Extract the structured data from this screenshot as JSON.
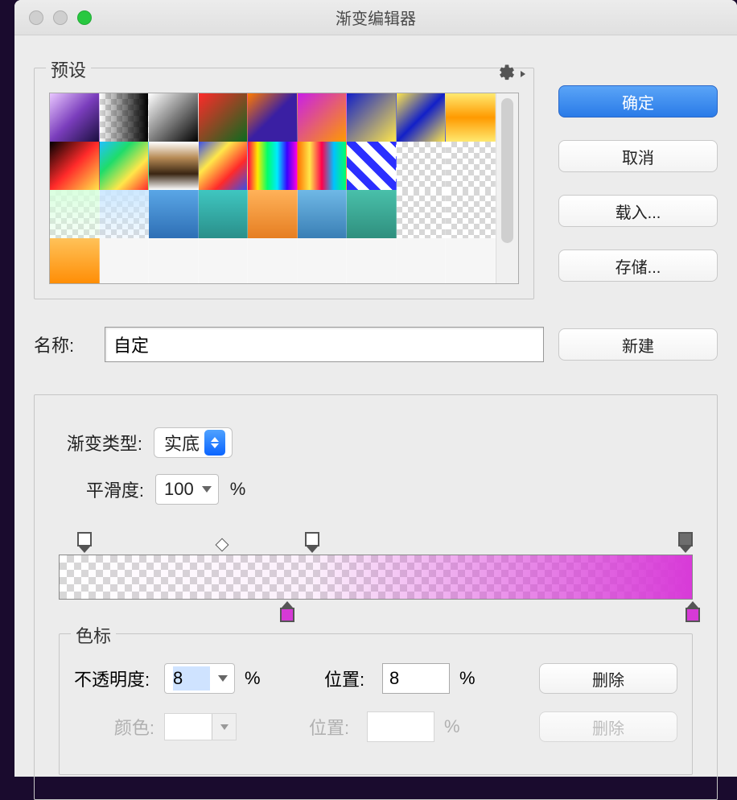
{
  "window": {
    "title": "渐变编辑器"
  },
  "buttons": {
    "ok": "确定",
    "cancel": "取消",
    "load": "载入...",
    "save": "存储...",
    "new": "新建",
    "delete": "删除"
  },
  "labels": {
    "presets": "预设",
    "name": "名称:",
    "gradient_type": "渐变类型:",
    "smoothness": "平滑度:",
    "stops": "色标",
    "opacity": "不透明度:",
    "location": "位置:",
    "color": "颜色:",
    "percent": "%"
  },
  "values": {
    "name": "自定",
    "gradient_type": "实底",
    "smoothness": "100",
    "opacity": "8",
    "opacity_location": "8",
    "color_location": ""
  },
  "presets": [
    {
      "bg": "linear-gradient(135deg,#e9c7ff,#7a3dbc,#1a0f3f)"
    },
    {
      "bg": "linear-gradient(90deg,rgba(0,0,0,0),#000)",
      "chk": true
    },
    {
      "bg": "linear-gradient(135deg,#fff,#000)"
    },
    {
      "bg": "linear-gradient(135deg,#ff2a2a,#0b6b1e)"
    },
    {
      "bg": "linear-gradient(135deg,#ff7a00,#3a1fa3,#3a1fa3)"
    },
    {
      "bg": "linear-gradient(135deg,#c91fe8,#ff9a00)"
    },
    {
      "bg": "linear-gradient(135deg,#1220c8,#ffe74a)"
    },
    {
      "bg": "linear-gradient(135deg,#ffe74a,#1220c8,#ffe74a)"
    },
    {
      "bg": "linear-gradient(180deg,#ffe970,#ff9a00,#ffe970)"
    },
    {
      "bg": "linear-gradient(135deg,#000,#ff2a2a,#ffe74a)"
    },
    {
      "bg": "linear-gradient(135deg,#22c1ff,#1fdc6a,#ffe74a,#ff2a2a)"
    },
    {
      "bg": "linear-gradient(180deg,#fff,#b78b55,#3a2613,#fff)"
    },
    {
      "bg": "linear-gradient(135deg,#3a4fe8,#ffe74a,#ff2a2a,#3a4fe8)"
    },
    {
      "bg": "linear-gradient(90deg,#ff004c,#ffea00,#00ff6a,#00eaff,#3a00ff,#ff00e1)"
    },
    {
      "bg": "linear-gradient(90deg,#ff7200,#ffe74a,#ff004c,#00c2ff,#00ff6a)"
    },
    {
      "bg": "repeating-linear-gradient(45deg,#2b2fff 0 10px,#fff 10px 20px)"
    },
    {
      "bg": "",
      "chk": true
    },
    {
      "bg": "",
      "chk": true
    },
    {
      "bg": "linear-gradient(180deg,rgba(214,255,220,.9),rgba(214,255,220,.2))",
      "chk": true
    },
    {
      "bg": "linear-gradient(180deg,rgba(200,230,255,.9),rgba(200,230,255,.2))",
      "chk": true
    },
    {
      "bg": "linear-gradient(180deg,#5aa6e6,#2e6fb5)"
    },
    {
      "bg": "linear-gradient(180deg,#3fc6c0,#2a8f8a)"
    },
    {
      "bg": "linear-gradient(180deg,#ffb259,#e67e22)"
    },
    {
      "bg": "linear-gradient(180deg,#6fb8e6,#3a7fb5)"
    },
    {
      "bg": "linear-gradient(180deg,#49c0aa,#2f8f7e)"
    },
    {
      "bg": "",
      "chk": true
    },
    {
      "bg": "",
      "chk": true
    },
    {
      "bg": "linear-gradient(180deg,#ffc259,#ff8a00)"
    }
  ],
  "gradient": {
    "opacity_stops": [
      {
        "pos": 0.04,
        "opacity": 0
      },
      {
        "pos": 0.4,
        "opacity": 8
      }
    ],
    "midpoint": 0.25,
    "color_stops": [
      {
        "pos": 0.36,
        "color": "#d63ad6"
      },
      {
        "pos": 1.0,
        "color": "#d63ad6"
      }
    ]
  }
}
